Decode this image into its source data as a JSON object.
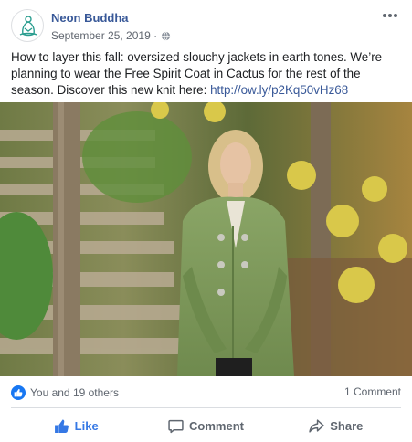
{
  "post": {
    "page_name": "Neon Buddha",
    "date": "September 25, 2019 ·",
    "text": "How to layer this fall: oversized slouchy jackets in earth tones. We’re planning to wear the Free Spirit Coat in Cactus for the rest of the season. Discover this new knit here: ",
    "link": "http://ow.ly/p2Kq50vHz68",
    "reactions_text": "You and 19 others",
    "comments_text": "1 Comment"
  },
  "actions": {
    "like": "Like",
    "comment": "Comment",
    "share": "Share"
  },
  "colors": {
    "page_name": "#385898",
    "like_active": "#3578e5",
    "muted": "#606770",
    "coat_green": "#7d9a5a"
  },
  "icons": {
    "avatar": "buddha-logo-icon",
    "privacy": "globe-icon",
    "menu": "more-options-icon",
    "reaction": "like-reaction-icon",
    "like": "thumbs-up-icon",
    "comment": "comment-bubble-icon",
    "share": "share-arrow-icon"
  }
}
